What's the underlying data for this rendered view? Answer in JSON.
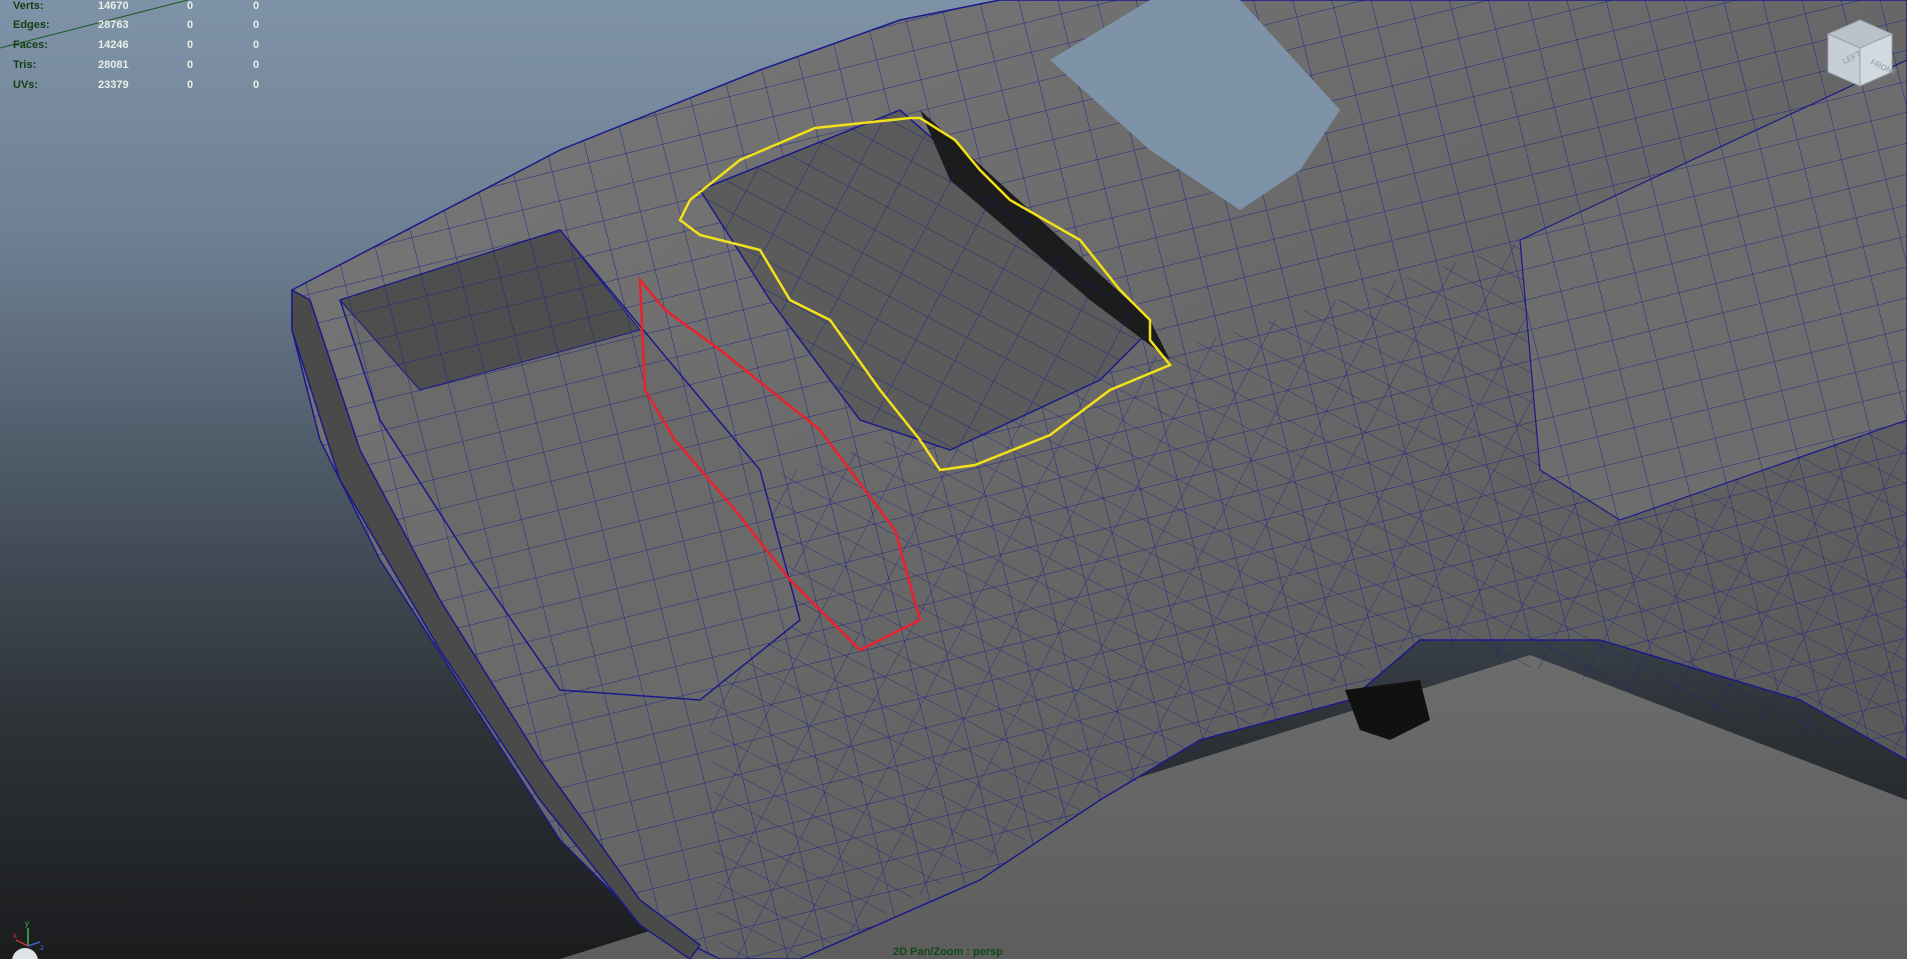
{
  "hud": {
    "rows": [
      {
        "label": "Verts:",
        "v1": "14670",
        "v2": "0",
        "v3": "0"
      },
      {
        "label": "Edges:",
        "v1": "28763",
        "v2": "0",
        "v3": "0"
      },
      {
        "label": "Faces:",
        "v1": "14246",
        "v2": "0",
        "v3": "0"
      },
      {
        "label": "Tris:",
        "v1": "28081",
        "v2": "0",
        "v3": "0"
      },
      {
        "label": "UVs:",
        "v1": "23379",
        "v2": "0",
        "v3": "0"
      }
    ]
  },
  "viewport": {
    "camera_label": "2D Pan/Zoom : persp",
    "wire_color": "#1a1a8a",
    "annotation_colors": {
      "yellow": "#f2e11a",
      "red": "#e8232d"
    }
  },
  "view_cube": {
    "faces": [
      "FRONT",
      "LEFT"
    ]
  },
  "axis": {
    "x": "x",
    "y": "y",
    "z": "z"
  },
  "icons": {
    "view_cube": "view-cube-icon",
    "axis": "axis-gizmo-icon"
  }
}
